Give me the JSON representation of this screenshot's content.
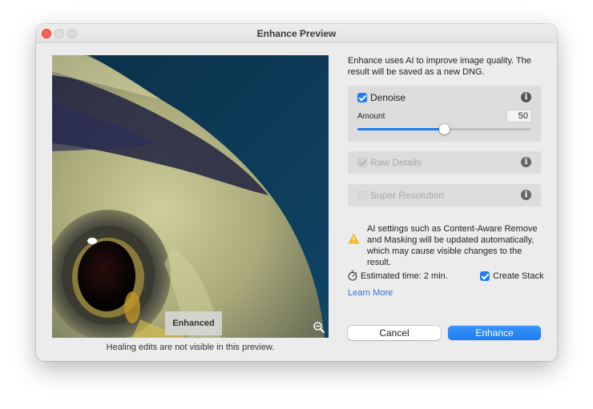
{
  "window": {
    "title": "Enhance Preview"
  },
  "preview": {
    "tag": "Enhanced",
    "note": "Healing edits are not visible in this preview.",
    "zoom_icon": "zoom-out-icon"
  },
  "intro": "Enhance uses AI to improve image quality. The result will be saved as a new DNG.",
  "options": {
    "denoise": {
      "label": "Denoise",
      "checked": true,
      "amount_label": "Amount",
      "amount_value": "50",
      "amount_fraction": 0.5
    },
    "raw_details": {
      "label": "Raw Details",
      "checked": true,
      "disabled": true
    },
    "super_resolution": {
      "label": "Super Resolution",
      "checked": false,
      "disabled": true
    },
    "info_glyph": "i"
  },
  "warning": {
    "icon": "warning-icon",
    "text": "AI settings such as Content-Aware Remove and Masking will be updated automatically, which may cause visible changes to the result."
  },
  "footer": {
    "timer_icon": "stopwatch-icon",
    "estimated_time": "Estimated time: 2 min.",
    "create_stack_label": "Create Stack",
    "create_stack_checked": true,
    "learn_more": "Learn More",
    "cancel_label": "Cancel",
    "enhance_label": "Enhance"
  },
  "colors": {
    "accent": "#1f7cf3",
    "close": "#fe5f57",
    "link": "#3a6fd8",
    "warning": "#f2b61f"
  }
}
